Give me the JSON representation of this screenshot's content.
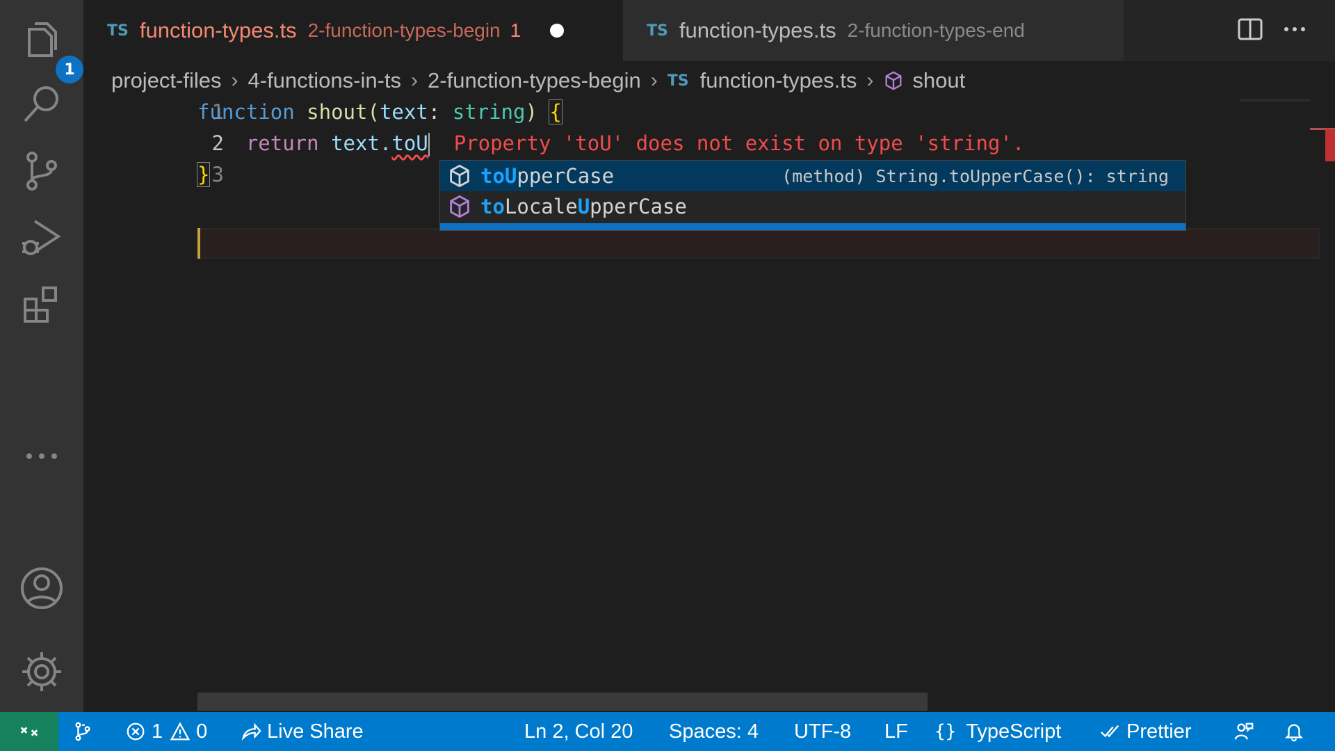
{
  "activity_bar": {
    "explorer_badge": "1",
    "items": [
      "explorer-icon",
      "search-icon",
      "source-control-icon",
      "run-debug-icon",
      "extensions-icon",
      "more-icon",
      "account-icon",
      "settings-gear-icon"
    ]
  },
  "tabs": [
    {
      "lang": "TS",
      "name": "function-types.ts",
      "description": "2-function-types-begin",
      "problems": "1",
      "dirty": true,
      "active": true
    },
    {
      "lang": "TS",
      "name": "function-types.ts",
      "description": "2-function-types-end",
      "dirty": false,
      "active": false
    }
  ],
  "breadcrumb": {
    "items": [
      "project-files",
      "4-functions-in-ts",
      "2-function-types-begin"
    ],
    "file_lang": "TS",
    "file": "function-types.ts",
    "symbol": "shout"
  },
  "editor": {
    "line_numbers": [
      "1",
      "2",
      "3"
    ],
    "line1": {
      "kw": "function",
      "fn": "shout",
      "open": "(",
      "param": "text",
      "colon": ": ",
      "type": "string",
      "close": ") ",
      "brace": "{"
    },
    "line2": {
      "indent": "    ",
      "kw": "return",
      "obj": " text.",
      "typed": "toU"
    },
    "line3": {
      "brace": "}"
    },
    "inline_error": "Property 'toU' does not exist on type 'string'."
  },
  "suggest": {
    "items": [
      {
        "hl1": "toU",
        "rest1": "pperCase",
        "detail": "(method) String.toUpperCase(): string",
        "selected": true
      },
      {
        "hl1": "to",
        "mid": "Locale",
        "hl2": "U",
        "rest": "pperCase",
        "selected": false
      }
    ]
  },
  "status_bar": {
    "errors": "1",
    "warnings": "0",
    "live_share": "Live Share",
    "position": "Ln 2, Col 20",
    "spaces": "Spaces: 4",
    "encoding": "UTF-8",
    "eol": "LF",
    "language": "TypeScript",
    "formatter": "Prettier"
  },
  "colors": {
    "accent": "#007acc",
    "remote": "#16825d",
    "error": "#f14c4c",
    "highlight": "#18a3ff"
  }
}
